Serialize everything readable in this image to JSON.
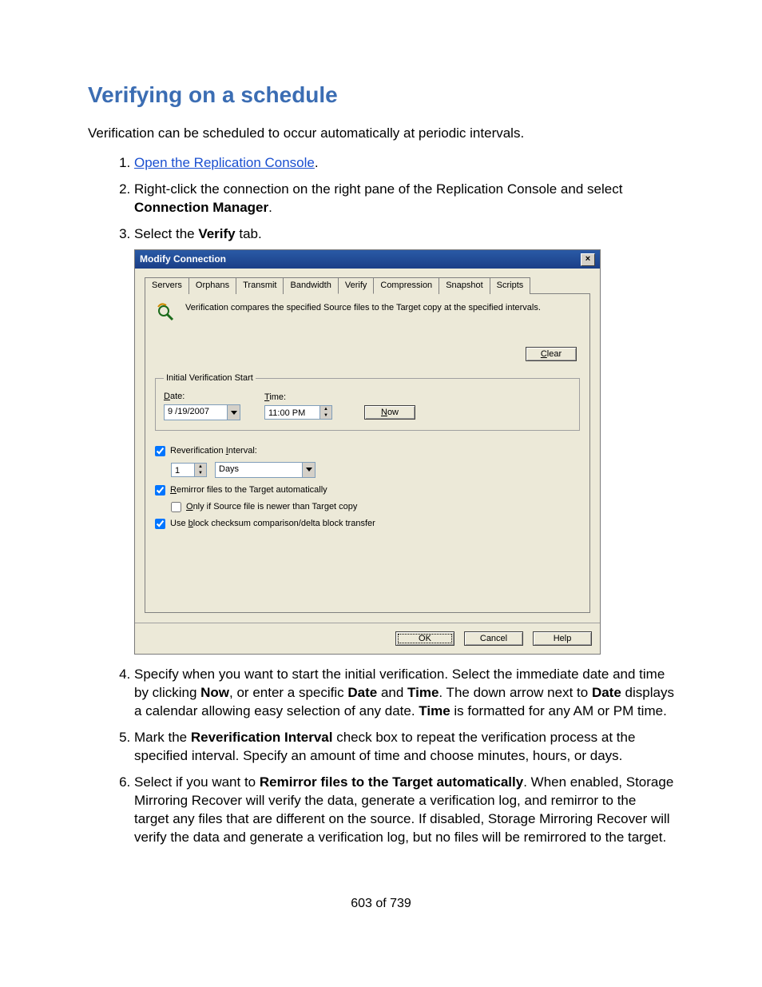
{
  "heading": "Verifying on a schedule",
  "intro": "Verification can be scheduled to occur automatically at periodic intervals.",
  "steps": {
    "s1_link": "Open the Replication Console",
    "s1_suffix": ".",
    "s2_a": "Right-click the connection on the right pane of the Replication Console and select ",
    "s2_bold": "Connection Manager",
    "s2_c": ".",
    "s3_a": "Select the ",
    "s3_bold": "Verify",
    "s3_c": " tab.",
    "s4_a": "Specify when you want to start the initial verification. Select the immediate date and time by clicking ",
    "s4_b1": "Now",
    "s4_b": ", or enter a specific ",
    "s4_b2": "Date",
    "s4_c": " and ",
    "s4_b3": "Time",
    "s4_d": ". The down arrow next to ",
    "s4_b4": "Date",
    "s4_e": " displays a calendar allowing easy selection of any date. ",
    "s4_b5": "Time",
    "s4_f": " is formatted for any AM or PM time.",
    "s5_a": "Mark the ",
    "s5_b1": "Reverification Interval",
    "s5_b": " check box to repeat the verification process at the specified interval. Specify an amount of time and choose minutes, hours, or days.",
    "s6_a": "Select if you want to ",
    "s6_b1": "Remirror files to the Target automatically",
    "s6_b": ". When enabled, Storage Mirroring Recover will verify the data, generate a verification log, and remirror to the target any files that are different on the source. If disabled, Storage Mirroring Recover will verify the data and generate a verification log, but no files will be remirrored to the target."
  },
  "dialog": {
    "title": "Modify Connection",
    "close": "×",
    "tabs": [
      "Servers",
      "Orphans",
      "Transmit",
      "Bandwidth",
      "Verify",
      "Compression",
      "Snapshot",
      "Scripts"
    ],
    "active_tab_index": 4,
    "description": "Verification compares the specified Source files to the Target copy at the specified intervals.",
    "clear_btn": "Clear",
    "group_legend": "Initial Verification Start",
    "date_label": "Date:",
    "date_value": "9 /19/2007",
    "time_label": "Time:",
    "time_value": "11:00 PM",
    "now_btn": "Now",
    "reverif_label": "Reverification Interval:",
    "reverif_value": "1",
    "reverif_unit": "Days",
    "remirror_label": "Remirror files to the Target automatically",
    "onlyif_label": "Only if Source file is newer than Target copy",
    "checksum_label": "Use block checksum comparison/delta block transfer",
    "ok": "OK",
    "cancel": "Cancel",
    "help": "Help",
    "reverif_checked": true,
    "remirror_checked": true,
    "onlyif_checked": false,
    "checksum_checked": true
  },
  "page_num": "603 of 739"
}
